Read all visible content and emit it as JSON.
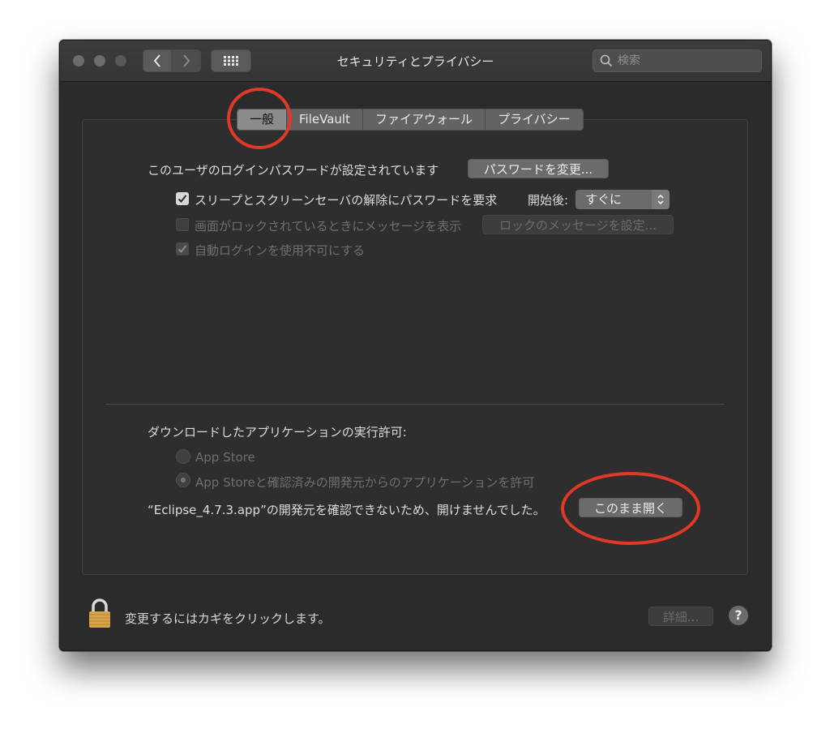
{
  "window": {
    "title": "セキュリティとプライバシー"
  },
  "search": {
    "placeholder": "検索"
  },
  "tabs": [
    {
      "label": "一般",
      "selected": true
    },
    {
      "label": "FileVault",
      "selected": false
    },
    {
      "label": "ファイアウォール",
      "selected": false
    },
    {
      "label": "プライバシー",
      "selected": false
    }
  ],
  "general": {
    "password_label": "このユーザのログインパスワードが設定されています",
    "change_password_button": "パスワードを変更...",
    "require_password_label": "スリープとスクリーンセーバの解除にパスワードを要求",
    "require_password_checked": true,
    "after_label": "開始後:",
    "after_value": "すぐに",
    "lock_message_label": "画面がロックされているときにメッセージを表示",
    "lock_message_checked": false,
    "set_lock_message_button": "ロックのメッセージを設定...",
    "disable_autologin_label": "自動ログインを使用不可にする",
    "disable_autologin_checked": true
  },
  "downloads": {
    "heading": "ダウンロードしたアプリケーションの実行許可:",
    "options": [
      {
        "label": "App Store",
        "selected": false
      },
      {
        "label": "App Storeと確認済みの開発元からのアプリケーションを許可",
        "selected": true
      }
    ],
    "blocked_message": "“Eclipse_4.7.3.app”の開発元を確認できないため、開けませんでした。",
    "open_anyway_button": "このまま開く"
  },
  "footer": {
    "lock_text": "変更するにはカギをクリックします。",
    "advanced_button": "詳細...",
    "help_label": "?"
  },
  "colors": {
    "annotation_ring": "#e03a27",
    "window_background": "#2b2b2c"
  }
}
